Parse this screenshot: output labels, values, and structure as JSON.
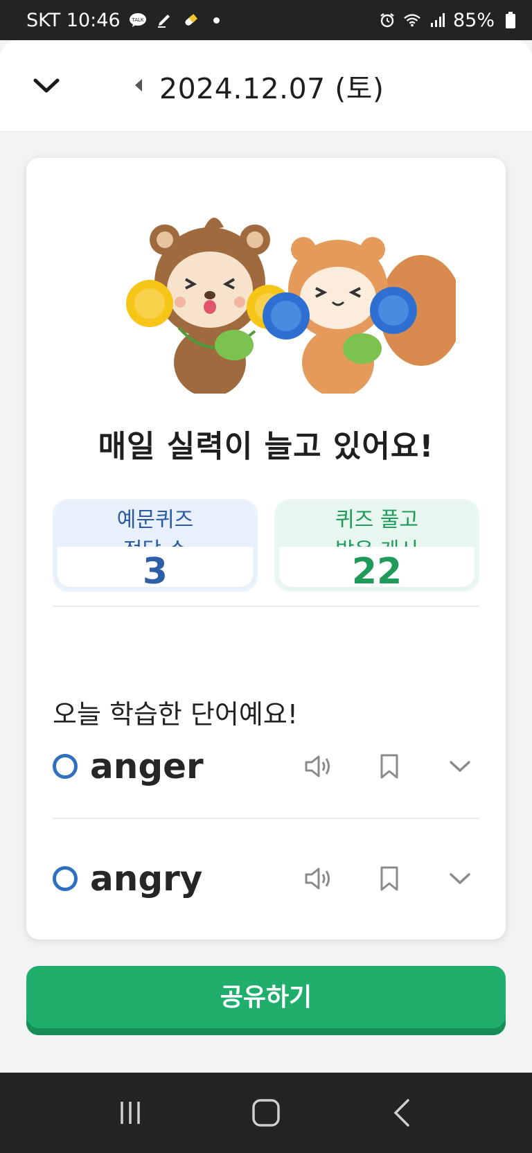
{
  "status_bar": {
    "carrier_time": "SKT 10:46",
    "battery": "85%",
    "icons": [
      "talk-icon",
      "pen-icon",
      "pill-icon",
      "alarm-icon",
      "wifi-icon",
      "signal-icon",
      "battery-icon"
    ]
  },
  "header": {
    "date": "2024.12.07 (토)",
    "collapse_icon": "chevron-down-icon",
    "prev_icon": "caret-left-icon"
  },
  "card": {
    "headline": "매일 실력이 늘고 있어요!",
    "stats": [
      {
        "label": "예문퀴즈\n정답 수",
        "value": "3"
      },
      {
        "label": "퀴즈 풀고\n받은 게시",
        "value": "22"
      }
    ],
    "section_title": "오늘 학습한 단어예요!",
    "words": [
      {
        "word": "anger"
      },
      {
        "word": "angry"
      }
    ]
  },
  "share_button": {
    "label": "공유하기"
  },
  "colors": {
    "accent_green": "#1fae6b",
    "accent_blue": "#2d5fa6",
    "mark_circle": "#2f6fbf"
  }
}
